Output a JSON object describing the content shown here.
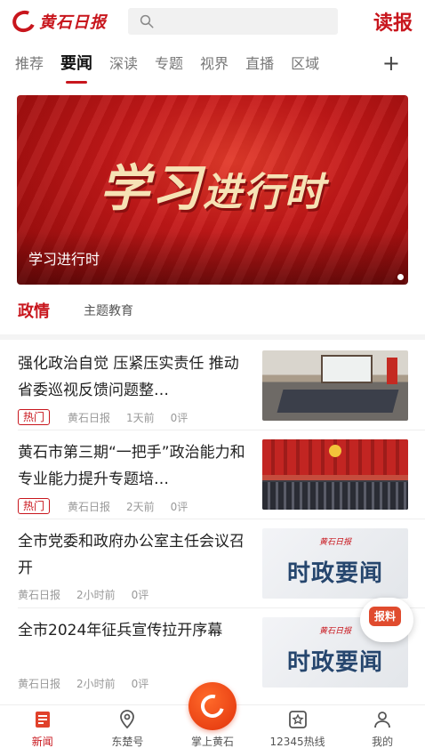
{
  "header": {
    "logo_text": "黄石日报",
    "search_placeholder": "",
    "read_label": "读报"
  },
  "tabs": [
    {
      "label": "推荐"
    },
    {
      "label": "要闻"
    },
    {
      "label": "深读"
    },
    {
      "label": "专题"
    },
    {
      "label": "视界"
    },
    {
      "label": "直播"
    },
    {
      "label": "区域"
    }
  ],
  "tab_add_label": "+",
  "banner": {
    "art_main": "学习",
    "art_small": "进行时",
    "caption": "学习进行时"
  },
  "section_tabs": [
    {
      "label": "政情"
    },
    {
      "label": "主题教育"
    }
  ],
  "news": [
    {
      "title": "强化政治自觉 压紧压实责任 推动省委巡视反馈问题整…",
      "tag": "热门",
      "source": "黄石日报",
      "time": "1天前",
      "comments": "0评",
      "thumb": "meeting-photo"
    },
    {
      "title": "黄石市第三期“一把手”政治能力和专业能力提升专题培…",
      "tag": "热门",
      "source": "黄石日报",
      "time": "2天前",
      "comments": "0评",
      "thumb": "meeting-photo"
    },
    {
      "title": "全市党委和政府办公室主任会议召开",
      "tag": "",
      "source": "黄石日报",
      "time": "2小时前",
      "comments": "0评",
      "thumb_text": "时政要闻",
      "thumb_logo": "黄石日报"
    },
    {
      "title": "全市2024年征兵宣传拉开序幕",
      "tag": "",
      "source": "黄石日报",
      "time": "2小时前",
      "comments": "0评",
      "thumb_text": "时政要闻",
      "thumb_logo": "黄石日报"
    }
  ],
  "report_label": "报料",
  "bottom_nav": [
    {
      "label": "新闻",
      "icon": "news-icon"
    },
    {
      "label": "东楚号",
      "icon": "location-icon"
    },
    {
      "label": "掌上黄石",
      "icon": "app-logo-icon"
    },
    {
      "label": "12345热线",
      "icon": "hotline-icon"
    },
    {
      "label": "我的",
      "icon": "user-icon"
    }
  ],
  "colors": {
    "brand_red": "#c8161d",
    "accent_orange": "#e1320b"
  }
}
